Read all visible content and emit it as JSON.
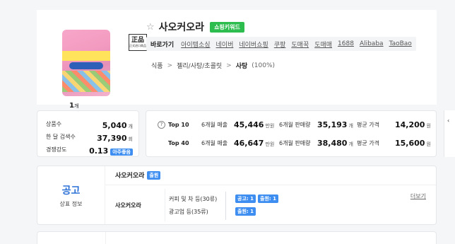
{
  "product": {
    "title": "사오커오라",
    "keyword_badge": "쇼핑키워드",
    "genuine_badge_main": "正品",
    "genuine_badge_sub": "正式进口商品",
    "quantity": "1",
    "quantity_unit": "개"
  },
  "shop_links": {
    "label": "바로가기",
    "items": [
      "아이템소싱",
      "네이버",
      "네이버쇼핑",
      "쿠팡",
      "도매꾹",
      "도매매",
      "1688",
      "Alibaba",
      "TaoBao"
    ]
  },
  "breadcrumb": {
    "items": [
      "식품",
      "젤리/사탕/초콜릿"
    ],
    "current": "사탕",
    "percent": "(100%)",
    "separator": ">"
  },
  "stats": {
    "rows": [
      {
        "label": "상품수",
        "value": "5,040",
        "unit": "개"
      },
      {
        "label": "한 달 검색수",
        "value": "37,390",
        "unit": "회"
      },
      {
        "label": "경쟁강도",
        "value": "0.13",
        "tag": "아주좋음"
      }
    ]
  },
  "top": {
    "help_icon_text": "?",
    "rows": [
      {
        "name": "Top 10",
        "sales_label": "6개월 매출",
        "sales": "45,446",
        "sales_unit": "만원",
        "qty_label": "6개월 판매량",
        "qty": "35,193",
        "qty_unit": "개",
        "price_label": "평균 가격",
        "price": "14,200",
        "price_unit": "원"
      },
      {
        "name": "Top 40",
        "sales_label": "6개월 매출",
        "sales": "46,647",
        "sales_unit": "만원",
        "qty_label": "6개월 판매량",
        "qty": "38,480",
        "qty_unit": "개",
        "price_label": "평균 가격",
        "price": "15,600",
        "price_unit": "원"
      }
    ]
  },
  "trademark": {
    "section_title": "공고",
    "section_sub": "상표 정보",
    "head_name": "사오커오라",
    "head_tag": "출원",
    "name": "사오커오라",
    "classes": [
      {
        "label": "커피 및 차 등(30류)",
        "tags": [
          "공고: 1",
          "출원: 1"
        ]
      },
      {
        "label": "광고업 등(35류)",
        "tags": [
          "출원: 1"
        ]
      }
    ],
    "more_label": "더보기"
  },
  "colors": {
    "accent_blue": "#3d8ef0",
    "keyword_green": "#2dbd4e",
    "title_blue": "#2a6fd6"
  }
}
